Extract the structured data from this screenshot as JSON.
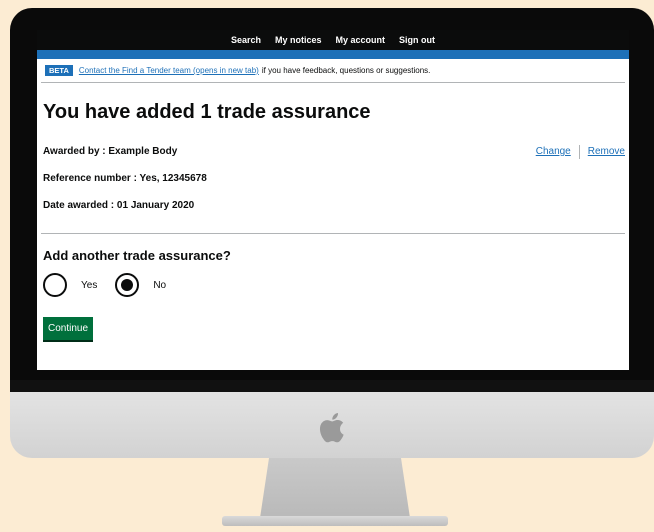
{
  "nav": {
    "items": [
      "Search",
      "My notices",
      "My account",
      "Sign out"
    ]
  },
  "banner": {
    "tag": "BETA",
    "link_text": "Contact the Find a Tender team (opens in new tab)",
    "suffix": "if you have feedback, questions or suggestions."
  },
  "page": {
    "title": "You have added 1 trade assurance"
  },
  "summary": {
    "awarded_by": "Awarded by : Example Body",
    "reference": "Reference number : Yes, 12345678",
    "date_awarded": "Date awarded : 01 January 2020",
    "change_label": "Change",
    "remove_label": "Remove"
  },
  "question": {
    "label": "Add another trade assurance?",
    "options": [
      {
        "label": "Yes",
        "selected": false
      },
      {
        "label": "No",
        "selected": true
      }
    ]
  },
  "continue_label": "Continue",
  "colors": {
    "nav_bg": "#0b0c0c",
    "blue": "#1d70b8",
    "button_green": "#00703c",
    "background": "#fcecd3"
  },
  "icons": {
    "logo": "apple-logo"
  }
}
